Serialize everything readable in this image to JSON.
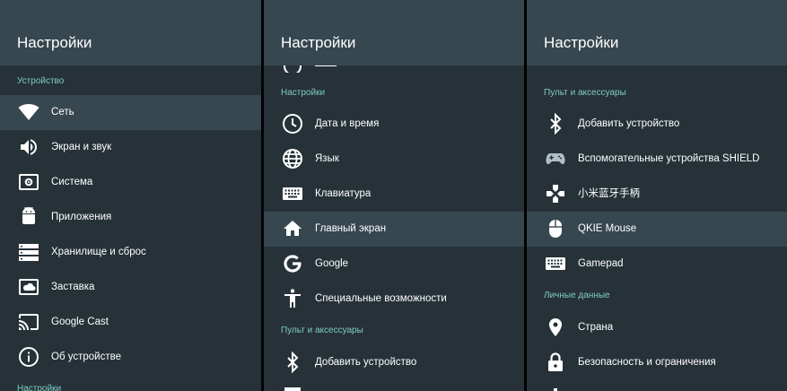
{
  "panel1": {
    "title": "Настройки",
    "section1": "Устройство",
    "items": [
      {
        "label": "Сеть",
        "icon": "wifi-icon"
      },
      {
        "label": "Экран и звук",
        "icon": "volume-icon"
      },
      {
        "label": "Система",
        "icon": "system-settings-icon"
      },
      {
        "label": "Приложения",
        "icon": "android-icon"
      },
      {
        "label": "Хранилище и сброс",
        "icon": "storage-icon"
      },
      {
        "label": "Заставка",
        "icon": "screensaver-icon"
      },
      {
        "label": "Google Cast",
        "icon": "cast-icon"
      },
      {
        "label": "Об устройстве",
        "icon": "info-icon"
      }
    ],
    "section2": "Настройки"
  },
  "panel2": {
    "title": "Настройки",
    "section1": "Настройки",
    "items": [
      {
        "label": "Дата и время",
        "icon": "clock-icon"
      },
      {
        "label": "Язык",
        "icon": "globe-icon"
      },
      {
        "label": "Клавиатура",
        "icon": "keyboard-icon"
      },
      {
        "label": "Главный экран",
        "icon": "home-icon"
      },
      {
        "label": "Google",
        "icon": "google-icon"
      },
      {
        "label": "Специальные возможности",
        "icon": "accessibility-icon"
      }
    ],
    "section2": "Пульт и аксессуары",
    "items2": [
      {
        "label": "Добавить устройство",
        "icon": "bluetooth-icon"
      }
    ]
  },
  "panel3": {
    "title": "Настройки",
    "section1": "Пульт и аксессуары",
    "items": [
      {
        "label": "Добавить устройство",
        "icon": "bluetooth-icon"
      },
      {
        "label": "Вспомогательные устройства SHIELD",
        "icon": "shield-controller-icon"
      },
      {
        "label": "小米蓝牙手柄",
        "icon": "gamepad-dpad-icon"
      },
      {
        "label": "QKIE Mouse",
        "icon": "mouse-icon"
      },
      {
        "label": "Gamepad",
        "icon": "keyboard-icon"
      }
    ],
    "section2": "Личные данные",
    "items2": [
      {
        "label": "Страна",
        "icon": "location-pin-icon"
      },
      {
        "label": "Безопасность и ограничения",
        "icon": "lock-icon"
      }
    ]
  },
  "colors": {
    "panel_bg": "#263238",
    "header_bg": "#37474f",
    "selected_bg": "#37474f",
    "section_text": "#80cbc4",
    "text": "#ffffff"
  },
  "selected": {
    "panel1": "Сеть",
    "panel2": "Главный экран",
    "panel3": "QKIE Mouse"
  }
}
